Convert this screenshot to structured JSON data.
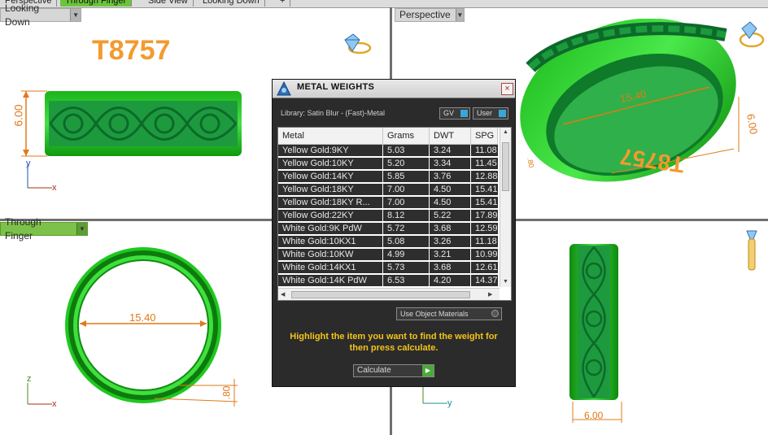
{
  "top_tabs": [
    "Perspective",
    "Through Finger",
    "Side View",
    "Looking Down",
    "+"
  ],
  "viewports": {
    "top_left": {
      "label": "Looking Down",
      "ring_text": "T8757",
      "dim_height": "6.00",
      "axis_h": "x",
      "axis_v": "y"
    },
    "top_right": {
      "label": "Perspective",
      "dim_diameter": "15.40",
      "dim_height": "6.00",
      "dim_small": ".80",
      "ring_text": "T8757"
    },
    "bottom_left": {
      "label": "Through Finger",
      "dim_diameter": "15.40",
      "dim_thickness": ".80",
      "axis_h": "x",
      "axis_v": "z"
    },
    "bottom_right": {
      "dim_width": "6.00",
      "axis_h": "y"
    }
  },
  "dialog": {
    "title": "METAL WEIGHTS",
    "close": "×",
    "library": "Library: Satin Blur - (Fast)-Metal",
    "gv_label": "GV",
    "user_label": "User",
    "columns": [
      "Metal",
      "Grams",
      "DWT",
      "SPG"
    ],
    "rows": [
      [
        "Yellow Gold:9KY",
        "5.03",
        "3.24",
        "11.08"
      ],
      [
        "Yellow Gold:10KY",
        "5.20",
        "3.34",
        "11.45"
      ],
      [
        "Yellow Gold:14KY",
        "5.85",
        "3.76",
        "12.88"
      ],
      [
        "Yellow Gold:18KY",
        "7.00",
        "4.50",
        "15.41"
      ],
      [
        "Yellow Gold:18KY R...",
        "7.00",
        "4.50",
        "15.41"
      ],
      [
        "Yellow Gold:22KY",
        "8.12",
        "5.22",
        "17.89"
      ],
      [
        "White Gold:9K PdW",
        "5.72",
        "3.68",
        "12.59"
      ],
      [
        "White Gold:10KX1",
        "5.08",
        "3.26",
        "11.18"
      ],
      [
        "White Gold:10KW",
        "4.99",
        "3.21",
        "10.99"
      ],
      [
        "White Gold:14KX1",
        "5.73",
        "3.68",
        "12.61"
      ],
      [
        "White Gold:14K PdW",
        "6.53",
        "4.20",
        "14.37"
      ]
    ],
    "use_object_materials": "Use Object Materials",
    "hint": "Highlight the item you want to find the weight for then press calculate.",
    "calculate": "Calculate",
    "colors": {
      "accent": "#f5c418",
      "panel": "#2b2b2b",
      "ring": "#22c222"
    }
  }
}
